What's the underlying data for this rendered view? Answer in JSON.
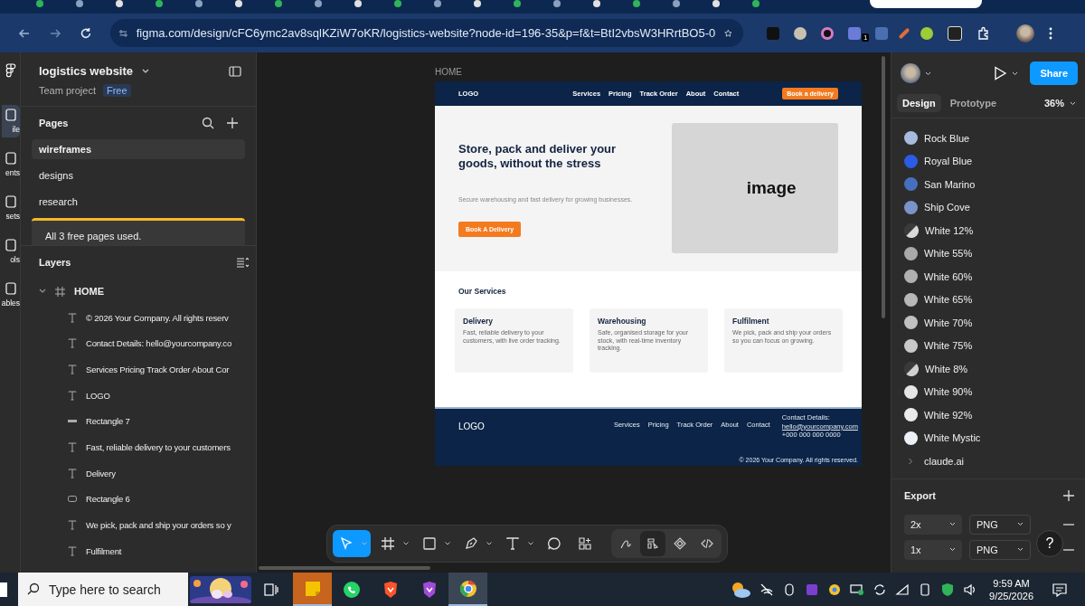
{
  "browser": {
    "url": "figma.com/design/cFC6ymc2av8sqlKZiW7oKR/logistics-website?node-id=196-35&p=f&t=BtI2vbsW3HRrtBO5-0",
    "extension_badge": "1"
  },
  "rail": [
    {
      "label": "ile",
      "selected": true
    },
    {
      "label": "ents",
      "selected": false
    },
    {
      "label": "sets",
      "selected": false
    },
    {
      "label": "ols",
      "selected": false
    },
    {
      "label": "ables",
      "selected": false
    }
  ],
  "file": {
    "title": "logistics website",
    "team": "Team project",
    "plan": "Free"
  },
  "pages": {
    "title": "Pages",
    "items": [
      {
        "label": "wireframes",
        "selected": true
      },
      {
        "label": "designs",
        "selected": false
      },
      {
        "label": "research",
        "selected": false
      }
    ],
    "notice": "All 3 free pages used."
  },
  "layers": {
    "title": "Layers",
    "root": {
      "name": "HOME",
      "expanded": true,
      "children": [
        {
          "kind": "text",
          "name": "© 2026 Your Company. All rights reserv"
        },
        {
          "kind": "text",
          "name": "Contact Details: hello@yourcompany.co"
        },
        {
          "kind": "text",
          "name": "Services Pricing Track Order About Cor"
        },
        {
          "kind": "text",
          "name": "LOGO"
        },
        {
          "kind": "line",
          "name": "Rectangle 7"
        },
        {
          "kind": "text",
          "name": "Fast, reliable delivery to your customers"
        },
        {
          "kind": "text",
          "name": "Delivery"
        },
        {
          "kind": "rect",
          "name": "Rectangle 6"
        },
        {
          "kind": "text",
          "name": "We pick, pack and ship your orders so y"
        },
        {
          "kind": "text",
          "name": "Fulfilment"
        }
      ]
    }
  },
  "canvas": {
    "frame_label": "HOME",
    "design": {
      "nav": {
        "logo": "LOGO",
        "links": [
          "Services",
          "Pricing",
          "Track Order",
          "About",
          "Contact"
        ],
        "cta": "Book a delivery"
      },
      "hero": {
        "heading": "Store, pack and deliver your goods, without the stress",
        "subtext": "Secure warehousing and fast delivery for growing businesses.",
        "button": "Book A Delivery",
        "image_label": "image"
      },
      "services": {
        "title": "Our Services",
        "cards": [
          {
            "title": "Delivery",
            "text": "Fast, reliable delivery to your customers, with live order tracking."
          },
          {
            "title": "Warehousing",
            "text": "Safe, organised storage for your stock, with real-time inventory tracking."
          },
          {
            "title": "Fulfilment",
            "text": "We pick, pack and ship your orders so you can focus on growing."
          }
        ]
      },
      "footer": {
        "logo": "LOGO",
        "links": [
          "Services",
          "Pricing",
          "Track Order",
          "About",
          "Contact"
        ],
        "contact_title": "Contact Details:",
        "email": "hello@yourcompany.com",
        "phone": "+000 000 000 0000",
        "copyright": "© 2026 Your Company. All rights reserved."
      }
    }
  },
  "right": {
    "share": "Share",
    "tabs": [
      {
        "label": "Design",
        "selected": true
      },
      {
        "label": "Prototype",
        "selected": false
      }
    ],
    "zoom": "36%",
    "styles": [
      {
        "name": "Rock Blue",
        "kind": "solid",
        "color": "#a8bbdc"
      },
      {
        "name": "Royal Blue",
        "kind": "solid",
        "color": "#2b5ce6"
      },
      {
        "name": "San Marino",
        "kind": "solid",
        "color": "#4670bd"
      },
      {
        "name": "Ship Cove",
        "kind": "solid",
        "color": "#7a93c9"
      },
      {
        "name": "White 12%",
        "kind": "translucent",
        "color": "#d9d9d9"
      },
      {
        "name": "White 55%",
        "kind": "solid",
        "color": "#a9a9a9"
      },
      {
        "name": "White 60%",
        "kind": "solid",
        "color": "#b0b0b0"
      },
      {
        "name": "White 65%",
        "kind": "solid",
        "color": "#b8b8b8"
      },
      {
        "name": "White 70%",
        "kind": "solid",
        "color": "#c0c0c0"
      },
      {
        "name": "White 75%",
        "kind": "solid",
        "color": "#c8c8c8"
      },
      {
        "name": "White 8%",
        "kind": "translucent",
        "color": "#d0d0d0"
      },
      {
        "name": "White 90%",
        "kind": "solid",
        "color": "#e6e6e6"
      },
      {
        "name": "White 92%",
        "kind": "solid",
        "color": "#ebebeb"
      },
      {
        "name": "White Mystic",
        "kind": "solid",
        "color": "#eef0f8"
      }
    ],
    "group": {
      "label": "claude.ai",
      "expanded": false
    },
    "export": {
      "title": "Export",
      "rows": [
        {
          "scale": "2x",
          "format": "PNG"
        },
        {
          "scale": "1x",
          "format": "PNG"
        }
      ]
    },
    "help": "?"
  },
  "toolbar": {
    "tools": [
      {
        "selected": true
      },
      {
        "selected": false
      },
      {
        "selected": false
      },
      {
        "selected": false
      },
      {
        "selected": false
      },
      {
        "selected": false
      },
      {
        "selected": false
      }
    ],
    "modes": [
      {
        "selected": false
      },
      {
        "selected": true
      },
      {
        "selected": false
      },
      {
        "selected": false
      }
    ]
  },
  "taskbar": {
    "search_placeholder": "Type here to search",
    "apps": [
      {
        "selected": true
      },
      {
        "selected": false
      },
      {
        "selected": false
      },
      {
        "selected": false
      },
      {
        "selected": true
      }
    ],
    "time": "9:59 AM",
    "date": "9/25/2026"
  }
}
